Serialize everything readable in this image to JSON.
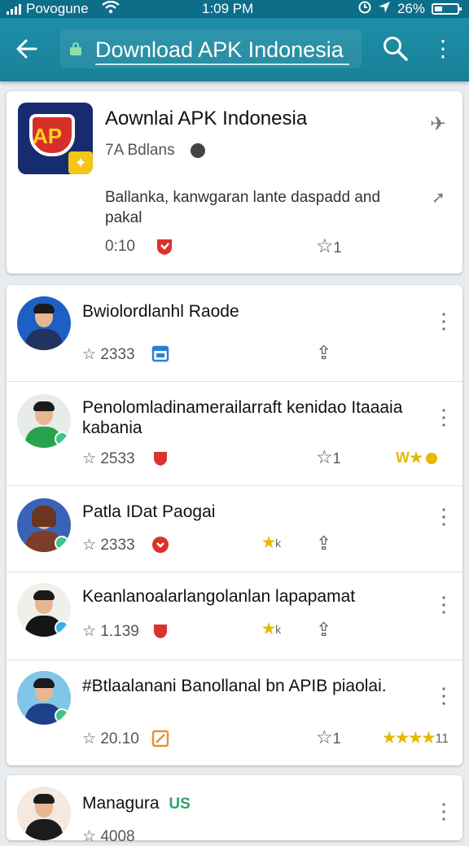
{
  "status_bar": {
    "carrier": "Povogune",
    "time": "1:09 PM",
    "battery": "26%"
  },
  "app_bar": {
    "title": "Download APK Indonesia"
  },
  "featured": {
    "name": "Aownlai APK Indonesia",
    "subtitle": "7A Bdlans",
    "description": "Ballanka, kanwgaran lante daspadd and pakal",
    "time": "0:10",
    "star_count": "1"
  },
  "items": [
    {
      "title": "Bwiolordlanhl Raode",
      "rating": "2333",
      "extra": ""
    },
    {
      "title": "Penolomladinamerailarraft kenidao Itaaaia kabania",
      "rating": "2533",
      "star_count": "1",
      "extra": "W"
    },
    {
      "title": "Patla IDat Paogai",
      "rating": "2333",
      "extra": "k"
    },
    {
      "title": "Keanlanoalarlangolanlan lapapamat",
      "rating": "1.139",
      "extra": "k"
    },
    {
      "title": "#Btlaalanani Banollanal bn APIB piaolai.",
      "rating": "20.10",
      "star_count": "1",
      "extra": "11"
    }
  ],
  "last_item": {
    "title": "Managura",
    "tag": "US",
    "rating": "4008"
  }
}
